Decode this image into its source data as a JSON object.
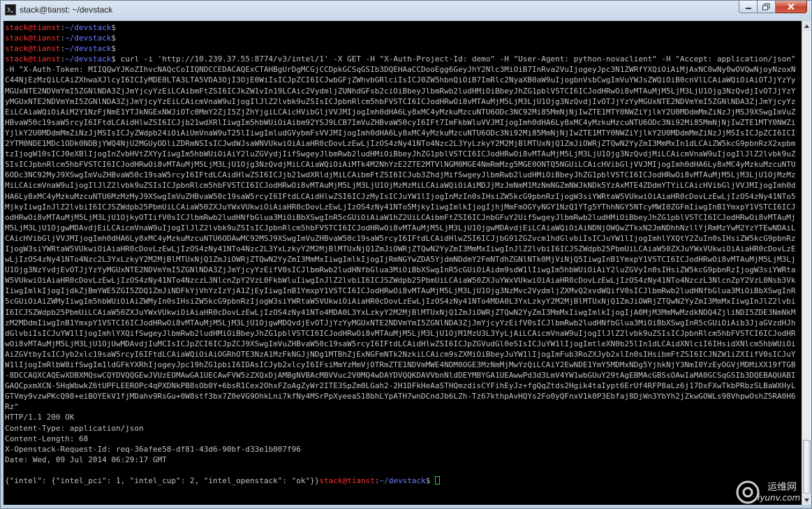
{
  "window": {
    "title": "stack@tianst: ~/devstack",
    "controls": [
      "minimize-icon",
      "maximize-icon",
      "close-icon"
    ]
  },
  "prompt": {
    "user_host": "stack@tianst",
    "sep": ":",
    "path": "~/devstack",
    "symbol": "$"
  },
  "commands": {
    "empty1": "",
    "empty2": "",
    "empty3": "",
    "curl": " curl -i 'http://10.239.37.55:8774/v3/intel/1' -X GET -H \"X-Auth-Project-Id: demo\" -H \"User-Agent: python-novaclient\" -H \"Accept: application/json\" -H \"X-Auth-Token: MIIQQwYJKoZIhvcNAQcCoIIQNDCCEDACAQExCTAHBgUrDgMCGjCCDpkGCSqGSIb3DQEHAaCCDooEgg6GeyJhY2Nlc3MiOiB7InRva2VuIjogeyJpc3N1ZWRfYXQiOiAiMjAxNC0wNy0wOVQwNjoyNzoxNC44NjEzMzQiLCAiZXhwaXJlcyI6ICIyMDE0LTA3LTA5VDA3OjI3OjE0WiIsICJpZCI6ICJwbGFjZWhvbGRlciIsICJ0ZW5hbnQiOiB7ImRlc2NyaXB0aW9uIjogbnVsbCwgImVuYWJsZWQiOiB0cnVlLCAiaWQiOiAiOTJjYzYyMGUxNTE2NDVmYmI5ZGNlNDA3ZjJmYjcyYzEiLCAibmFtZSI6ICJkZW1vIn19LCAic2VydmljZUNhdGFsb2ciOiBbeyJlbmRwb2ludHMiOiBbeyJhZG1pblVSTCI6ICJodHRwOi8vMTAuMjM5LjM3LjU1Ojg3NzQvdjIvOTJjYzYyMGUxNTE2NDVmYmI5ZGNlNDA3ZjJmYjcyYzEiLCAicmVnaW9uIjogIlJlZ2lvbk9uZSIsICJpbnRlcm5hbFVSTCI6ICJodHRwOi8vMTAuMjM5LjM3LjU1Ojg3NzQvdjIvOTJjYzYyMGUxNTE2NDVmYmI5ZGNlNDA3ZjJmYjcyYzEiLCAiaWQiOiAiM2Y1NzFjNmE1YTJkNGExNWJiOTc0MmY2ZjI5ZjZhYjgiLCAicHVibGljVVJMIjogImh0dHA6Ly8xMC4yMzkuMzcuNTU6ODc3NC92Mi85MmNjNjIwZTE1MTY0NWZiYjlkY2U0MDdmMmZiNzJjMSJ9XSwgImVuZHBvaW50c19saW5rcyI6IFtdLCAidHlwZSI6ICJjb21wdXRlIiwgIm5hbWUiOiAibm92YSJ9LCB7ImVuZHBvaW50cyI6IFt7ImFkbWluVVJMIjogImh0dHA6Ly8xMC4yMzkuMzcuNTU6ODc3Ni92Mi85MmNjNjIwZTE1MTY0NWZiYjlkY2U0MDdmMmZiNzJjMSIsICJyZWdpb24iOiAiUmVnaW9uT25lIiwgImludGVybmFsVVJMIjogImh0dHA6Ly8xMC4yMzkuMzcuNTU6ODc3Ni92Mi85MmNjNjIwZTE1MTY0NWZiYjlkY2U0MDdmMmZiNzJjMSIsICJpZCI6ICI2YTM0NDE1MDc1ODk0NDBjYWQ4NjU2MGUyODliZDRmNSIsICJwdWJsaWNVUkwiOiAiaHR0cDovLzEwLjIzOS4zNy41NTo4Nzc2L3YyLzkyY2M2MjBlMTUxNjQ1ZmJiOWRjZTQwN2YyZmI3MmMxIn1dLCAiZW5kcG9pbnRzX2xpbmtzIjogW10sICJ0eXBlIjogInZvbHVtZXYyIiwgIm5hbWUiOiAiY2luZGVydjIifSwgeyJlbmRwb2ludHMiOiBbeyJhZG1pblVSTCI6ICJodHRwOi8vMTAuMjM5LjM3LjU1Ojg3NzQvdjMiLCAicmVnaW9uIjogIlJlZ2lvbk9uZSIsICJpbnRlcm5hbFVSTCI6ICJodHRwOi8vMTAuMjM5LjM3LjU1Ojg3NzQvdjMiLCAiaWQiOiAiMTk4M2NhYzE2ZTE2MTVlNGM0MGE4NmRmMzg5MGE0ONTQ5NGUiLCAicHVibGljVVJMIjogImh0dHA6Ly8xMC4yMzkuMzcuNTU6ODc3NC92MyJ9XSwgImVuZHBvaW50c19saW5rcyI6IFtdLCAidHlwZSI6ICJjb21wdXRldjMiLCAibmFtZSI6ICJub3ZhdjMifSwgeyJlbmRwb2ludHMiOiBbeyJhZG1pblVSTCI6ICJodHRwOi8vMTAuMjM5LjM3LjU1OjMzMzMiLCAicmVnaW9uIjogIlJlZ2lvbk9uZSIsICJpbnRlcm5hbFVSTCI6ICJodHRwOi8vMTAuMjM5LjM3LjU1OjMzMzMiLCAiaWQiOiAiMDJjMzJmNmM1MzNmNGZmNWJkNDk5YzAxMTE4ZDdmYTYiLCAicHVibGljVVJMIjogImh0dHA6Ly8xMC4yMzkuMzcuNTU6MzMzMyJ9XSwgImVuZHBvaW50c19saW5rcyI6IFtdLCAidHlwZSI6ICJzMyIsICJuYW1lIjogInMzIn0sIHsiZW5kcG9pbnRzIjogW3siYWRtaW5VUkwiOiAiaHR0cDovLzEwLjIzOS4zNy41NTo5MjkyIiwgInJlZ2lvbiI6ICJSZWdpb25PbmUiLCAiaW50ZXJuYWxVUkwiOiAiaHR0cDovLzEwLjIzOS4zNy41NTo5MjkyIiwgImlkIjogIjhjMmFmOGYyNGY1NzQ1YTg5YThhNGY5NTcyMWI0ZGFmIiwgInB1YmxpY1VSTCI6ICJodHRwOi8vMTAuMjM5LjM3LjU1OjkyOTIifV0sICJlbmRwb2ludHNfbGlua3MiOiBbXSwgInR5cGUiOiAiaW1hZ2UiLCAibmFtZSI6ICJnbGFuY2UifSwgeyJlbmRwb2ludHMiOiBbeyJhZG1pblVSTCI6ICJodHRwOi8vMTAuMjM5LjM3LjU1OjgwMDAvdjEiLCAicmVnaW9uIjogIlJlZ2lvbk9uZSIsICJpbnRlcm5hbFVSTCI6ICJodHRwOi8vMTAuMjM5LjM3LjU1OjgwMDAvdjEiLCAiaWQiOiAiNDNjOWQwZTkxN2JmNDhhNzllYjRmMzYwM2YzYTEwNDAiLCAicHVibGljVVJMIjogImh0dHA6Ly8xMC4yMzkuMzcuNTU6ODAwMC92MSJ9XSwgImVuZHBvaW50c19saW5rcyI6IFtdLCAidHlwZSI6ICJjbG91ZGZvcm1hdGlvbiIsICJuYW1lIjogImhlYXQtY2ZuIn0sIHsiZW5kcG9pbnRzIjogW3siYWRtaW5VUkwiOiAiaHR0cDovLzEwLjIzOS4zNy41NTo4Nzc2L3YxLzkyY2M2MjBlMTUxNjQ1ZmJiOWRjZTQwN2YyZmI3MmMxIiwgInJlZ2lvbiI6ICJSZWdpb25PbmUiLCAiaW50ZXJuYWxVUkwiOiAiaHR0cDovLzEwLjIzOS4zNy41NTo4Nzc2L3YxLzkyY2M2MjBlMTUxNjQ1ZmJiOWRjZTQwN2YyZmI3MmMxIiwgImlkIjogIjRmNGYwZDA5YjdmNDdmY2FmNTdhZGNlNTk0MjViNjQ5IiwgInB1YmxpY1VSTCI6ICJodHRwOi8vMTAuMjM5LjM3LjU1Ojg3NzYvdjEvOTJjYzYyMGUxNTE2NDVmYmI5ZGNlNDA3ZjJmYjcyYzEifV0sICJlbmRwb2ludHNfbGlua3MiOiBbXSwgInR5cGUiOiAidm9sdW1lIiwgIm5hbWUiOiAiY2luZGVyIn0sIHsiZW5kcG9pbnRzIjogW3siYWRtaW5VUkwiOiAiaHR0cDovLzEwLjIzOS4zNy41NTo4NzczL3NlcnZpY2VzL0FkbWluIiwgInJlZ2lvbiI6ICJSZWdpb25PbmUiLCAiaW50ZXJuYWxVUkwiOiAiaHR0cDovLzEwLjIzOS4zNy41NTo4NzczL3NlcnZpY2VzL0Nsb3VkIiwgImlkIjogIjdkZjBmYWE5ZGI5ZDQ1ZmJiNDFkYjVhYzIzYjA1ZjEyIiwgInB1YmxpY1VSTCI6ICJodHRwOi8vMTAuMjM5LjM3LjU1Ojg3NzMvc2VydmljZXMvQ2xvdWQifV0sICJlbmRwb2ludHNfbGlua3MiOiBbXSwgInR5cGUiOiAiZWMyIiwgIm5hbWUiOiAiZWMyIn0sIHsiZW5kcG9pbnRzIjogW3siYWRtaW5VUkwiOiAiaHR0cDovLzEwLjIzOS4zNy41NTo4MDA0L3YxLzkyY2M2MjBlMTUxNjQ1ZmJiOWRjZTQwN2YyZmI3MmMxIiwgInJlZ2lvbiI6ICJSZWdpb25PbmUiLCAiaW50ZXJuYWxVUkwiOiAiaHR0cDovLzEwLjIzOS4zNy41NTo4MDA0L3YxLzkyY2M2MjBlMTUxNjQ1ZmJiOWRjZTQwN2YyZmI3MmMxIiwgImlkIjogIjA0MjM3MmMwMzdkNDQ4ZjliNDI5ZDE3NmNkMzM2MDdmIiwgInB1YmxpY1VSTCI6ICJodHRwOi8vMTAuMjM5LjM3LjU1OjgwMDQvdjEvOTJjYzYyMGUxNTE2NDVmYmI5ZGNlNDA3ZjJmYjcyYzEifV0sICJlbmRwb2ludHNfbGlua3MiOiBbXSwgInR5cGUiOiAib3JjaGVzdHJhdGlvbiIsICJuYW1lIjogImhlYXQifSwgeyJlbmRwb2ludHMiOiBbeyJhZG1pblVSTCI6ICJodHRwOi8vMTAuMjM5LjM3LjU1OjM1MzU3L3YyLjAiLCAicmVnaW9uIjogIlJlZ2lvbk9uZSIsICJpbnRlcm5hbFVSTCI6ICJodHRwOi8vMTAuMjM5LjM3LjU1OjUwMDAvdjIuMCIsICJpZCI6ICJpZCJ9XSwgImVuZHBvaW50c19saW5rcyI6IFtdLCAidHlwZSI6ICJpZGVudGl0eSIsICJuYW1lIjogImtleXN0b25lIn1dLCAidXNlciI6IHsidXNlcm5hbWUiOiAiZGVtbyIsICJyb2xlc19saW5rcyI6IFtdLCAiaWQiOiAiOGRhOTE3NzA1MzFkNGJjNDg1MTBhZjExNGFmNTk2NzkiLCAicm9sZXMiOiBbeyJuYW1lIjogImFub3RoZXJyb2xlIn0sIHsibmFtZSI6ICJNZW1iZXIifV0sICJuYW1lIjogImRlbW8ifSwgIm1ldGFkYXRhIjogeyJpc19hZG1pbiI6IDAsICJyb2xlcyI6IFsiMmYzMmVjOTRmZTE1NDVmMWE4NDM0OGE3MzNmMjMwYzQiLCAiY2EwNDE1YmY5MDMxNDg5YjhkNjY3NmI0YzEyOGVjMDMiXX19fTGB-8DCCAQXCAQEwXDBXMQswCQYDVQQGEwJVUzEOMAwGA1UECAwFVW5zZXQxDjAMBgNVBAcMBVVuc2V0MQ4wDAYDVQQKDAVVbnNldDEYMBYGA1UEAwwPd3d3LmV4YW1wbGUuY29tAgEBMAcGBSsOAwIaMA0GCSqGSIb3DQEBAQUABIGAQCpxmXCN-5HqWbwkZ6tUPFLEEROPc4qPXDNkPB8sOb0Y+6bsR1Cex2OhxFZoAgZyWr2ITE3SpZm0LGah2-2H1DFkHeAaSTHQmzdisCYFihEyJz+fgQqZtds2Hgik4taIypt6ErUf4RFP8aLz6j17DxFXwTkbPRbzSLBaWXHyLGTVmy9vzwPKcQ98+eiBOYEkV1fjMDahv9RsGu+0W8stf3bx7Z0eVG9OhkLni7kfNy4MSrPpXyeeaS18bhLYpATH7wnDCndJb6LZh-Tz67kthpAvHQYs2Fo0yQFnxV1k0P3Ebfaj8DjWn3YbYh2jZkwGOWLs98VhpwOshZ5RA0H6Rz\""
  },
  "response": {
    "status": "HTTP/1.1 200 OK",
    "content_type": "Content-Type: application/json",
    "content_length": "Content-Length: 68",
    "request_id": "X-Openstack-Request-Id: req-36afee58-df81-43d6-90bf-d33e1b007f96",
    "date": "Date: Wed, 09 Jul 2014 06:29:17 GMT",
    "blank": "",
    "body": "{\"intel\": {\"intel_pci\": 1, \"intel_cup\": 2, \"intel_openstack\": \"ok\"}}"
  },
  "watermark": {
    "text": "运维网",
    "url": "iyunv.com"
  }
}
